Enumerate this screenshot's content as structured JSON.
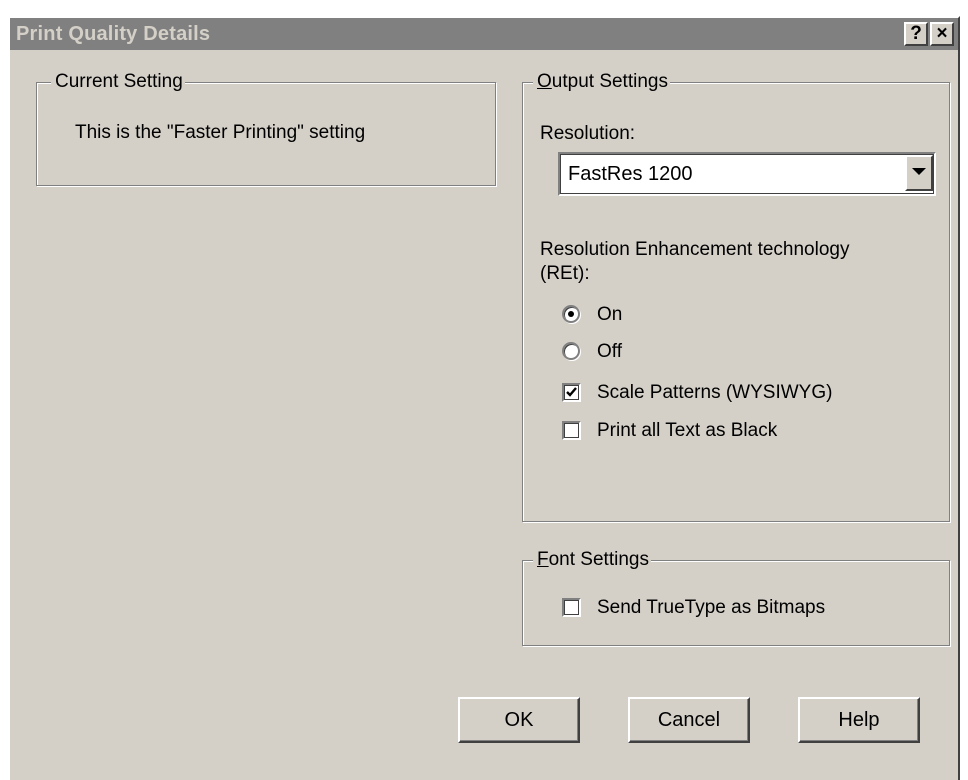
{
  "window": {
    "title": "Print Quality Details",
    "help_button": "?",
    "close_button": "×"
  },
  "current_setting": {
    "legend": "Current Setting",
    "text": "This is the \"Faster Printing\" setting"
  },
  "output_settings": {
    "legend_accel": "O",
    "legend_rest": "utput Settings",
    "resolution_label": "Resolution:",
    "resolution_value": "FastRes 1200",
    "ret_label_line1": "Resolution Enhancement technology",
    "ret_label_line2": "(REt):",
    "radio_on_label": "On",
    "radio_on_selected": true,
    "radio_off_label": "Off",
    "radio_off_selected": false,
    "scale_patterns_label": "Scale Patterns (WYSIWYG)",
    "scale_patterns_checked": true,
    "print_black_label": "Print all Text as Black",
    "print_black_checked": false
  },
  "font_settings": {
    "legend_accel": "F",
    "legend_rest": "ont Settings",
    "truetype_label": "Send TrueType as Bitmaps",
    "truetype_checked": false
  },
  "buttons": {
    "ok": "OK",
    "cancel": "Cancel",
    "help": "Help"
  },
  "icons": {
    "dropdown": "chevron-down-icon",
    "check": "checkmark-icon",
    "help": "question-icon",
    "close": "close-icon"
  }
}
